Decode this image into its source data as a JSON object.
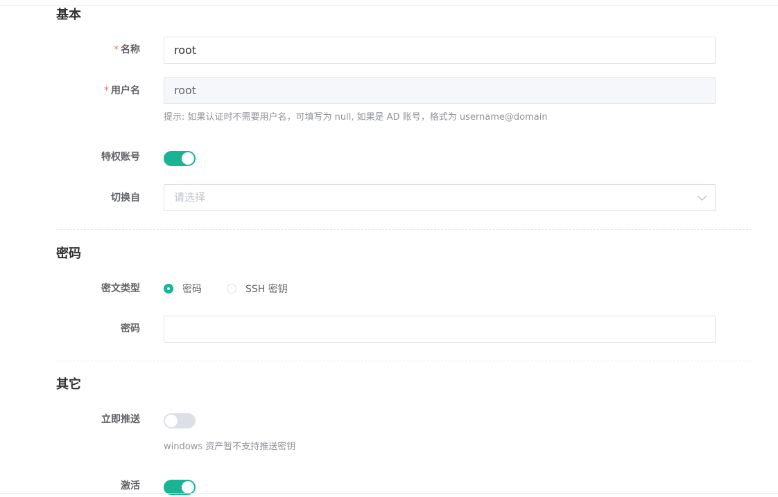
{
  "sections": {
    "basic": "基本",
    "password": "密码",
    "other": "其它"
  },
  "fields": {
    "name": {
      "label": "名称",
      "required_mark": "*",
      "value": "root"
    },
    "username": {
      "label": "用户名",
      "required_mark": "*",
      "value": "root",
      "hint": "提示: 如果认证时不需要用户名，可填写为 null, 如果是 AD 账号，格式为 username@domain"
    },
    "privileged": {
      "label": "特权账号",
      "on": true
    },
    "su_from": {
      "label": "切换自",
      "placeholder": "请选择"
    },
    "secret_type": {
      "label": "密文类型",
      "options": [
        "密码",
        "SSH 密钥"
      ],
      "selected": "密码"
    },
    "password": {
      "label": "密码",
      "value": ""
    },
    "push_now": {
      "label": "立即推送",
      "on": false,
      "hint": "windows 资产暂不支持推送密钥"
    },
    "active": {
      "label": "激活",
      "on": true
    }
  },
  "colors": {
    "accent": "#1ab394",
    "required": "#f56c6c"
  }
}
